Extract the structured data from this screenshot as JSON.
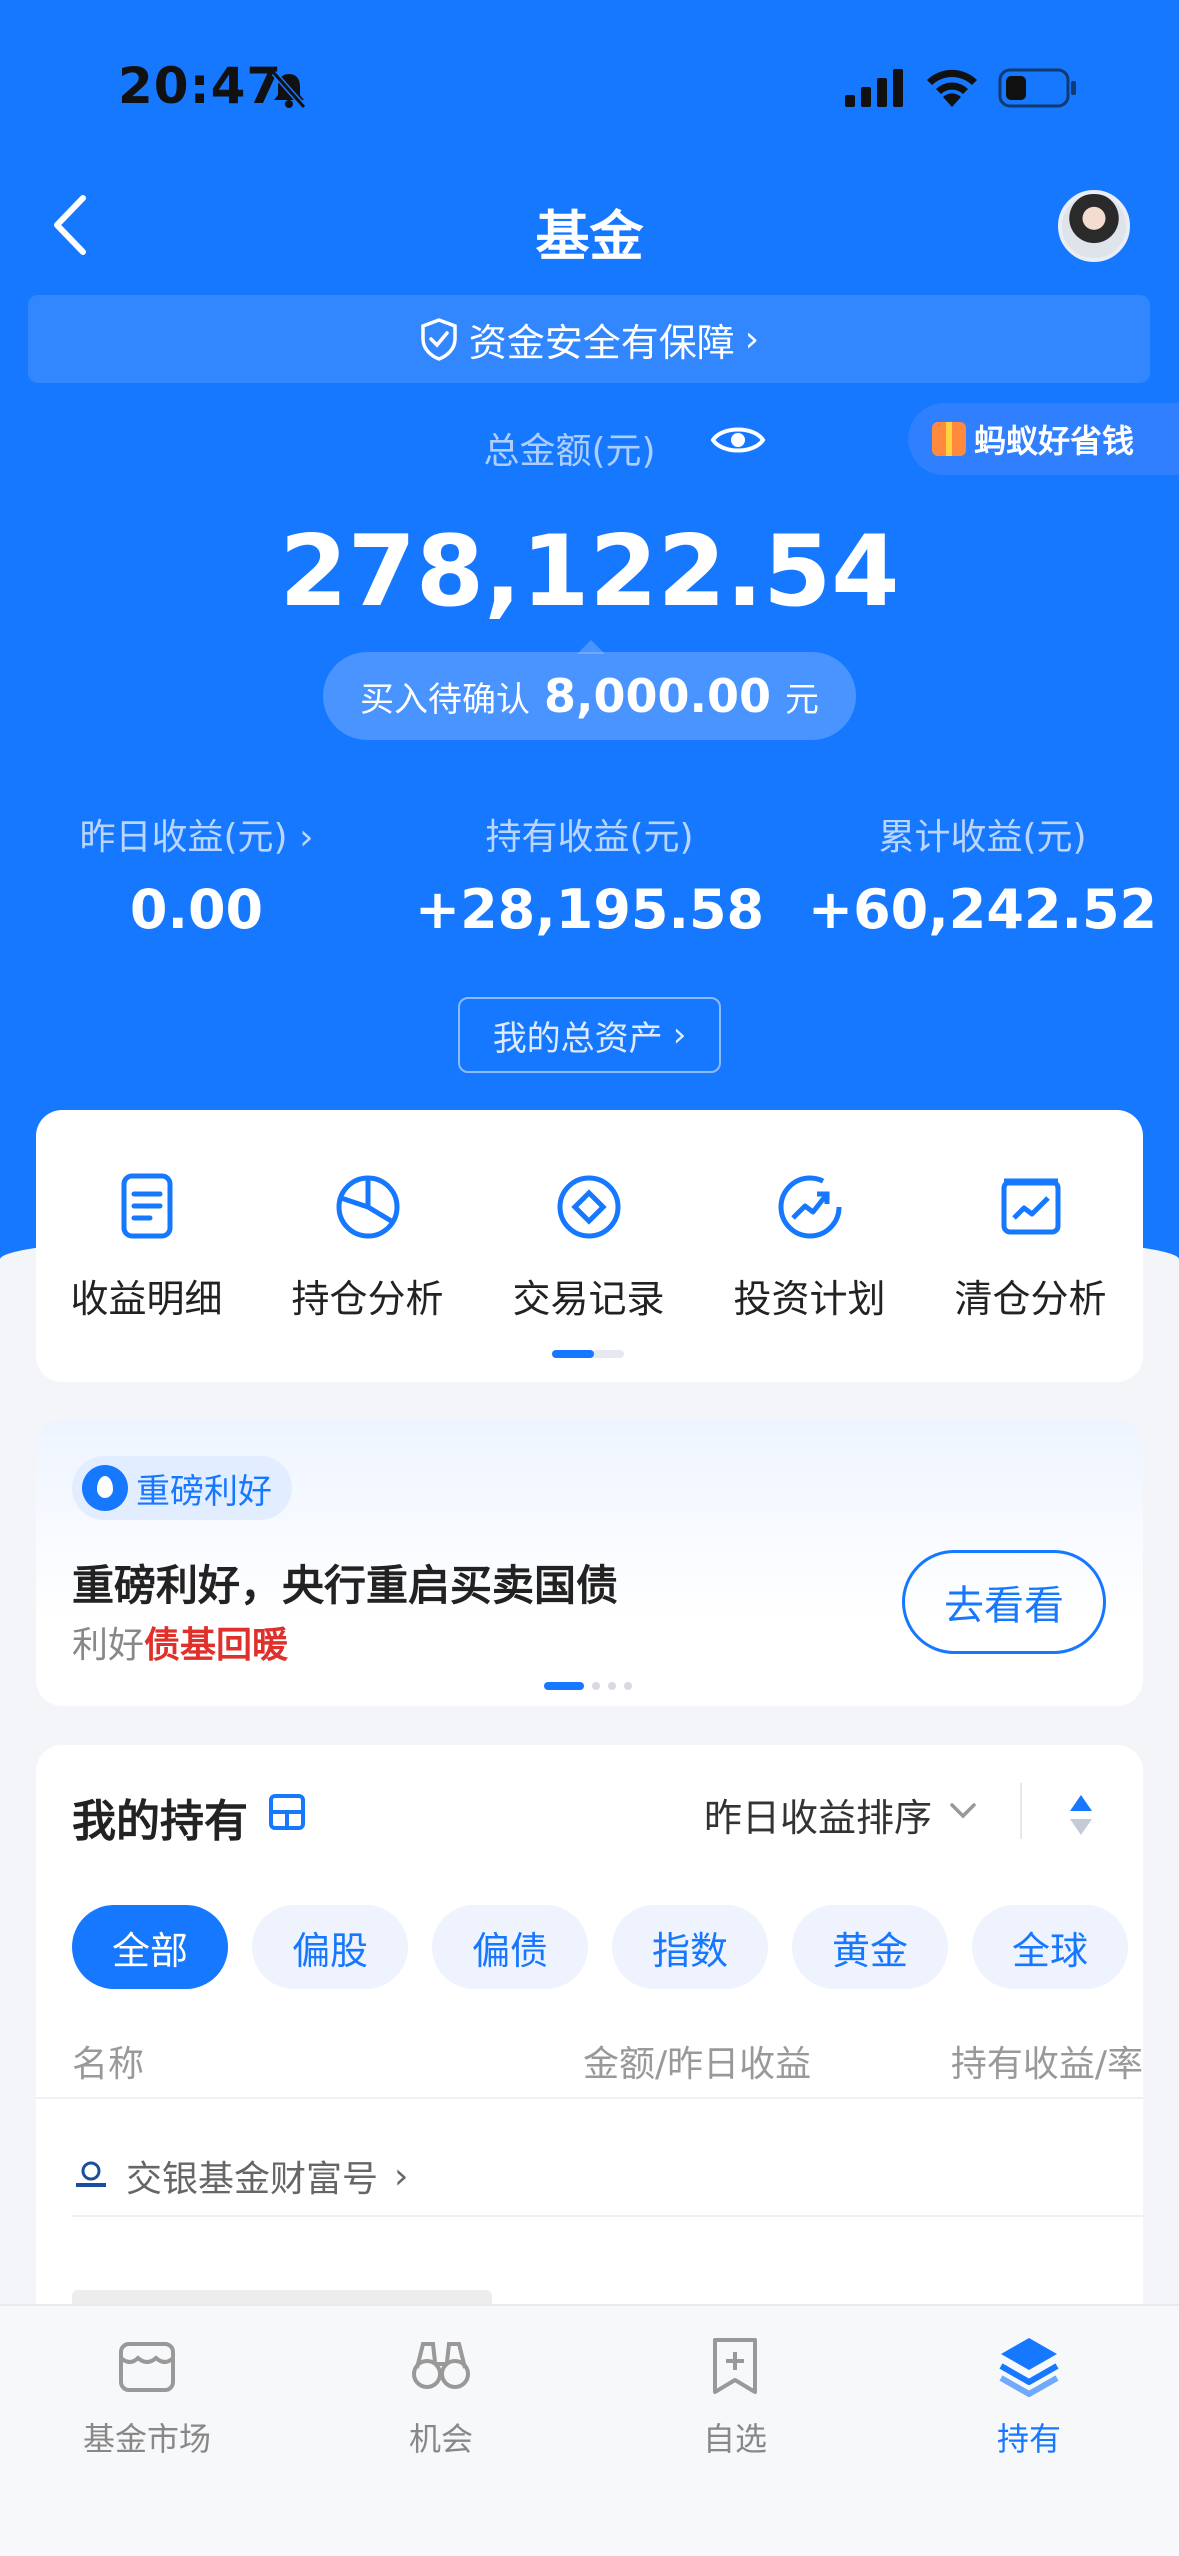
{
  "status_bar": {
    "time": "20:47"
  },
  "nav": {
    "title": "基金"
  },
  "safety": {
    "label": "资金安全有保障"
  },
  "promo": {
    "label": "蚂蚁好省钱"
  },
  "total": {
    "label": "总金额(元)",
    "amount": "278,122.54",
    "pending_label": "买入待确认",
    "pending_amount": "8,000.00",
    "pending_unit": "元"
  },
  "stats": [
    {
      "label": "昨日收益(元)",
      "value": "0.00"
    },
    {
      "label": "持有收益(元)",
      "value": "+28,195.58"
    },
    {
      "label": "累计收益(元)",
      "value": "+60,242.52"
    }
  ],
  "assets_button": "我的总资产",
  "functions": [
    {
      "label": "收益明细",
      "icon": "document-icon"
    },
    {
      "label": "持仓分析",
      "icon": "pie-chart-icon"
    },
    {
      "label": "交易记录",
      "icon": "transaction-icon"
    },
    {
      "label": "投资计划",
      "icon": "trend-up-icon"
    },
    {
      "label": "清仓分析",
      "icon": "chart-box-icon"
    }
  ],
  "news": {
    "tag": "重磅利好",
    "title": "重磅利好，央行重启买卖国债",
    "sub_prefix": "利好",
    "sub_highlight": "债基回暖",
    "button": "去看看"
  },
  "holdings": {
    "title": "我的持有",
    "sort_label": "昨日收益排序",
    "chips": [
      "全部",
      "偏股",
      "偏债",
      "指数",
      "黄金",
      "全球"
    ],
    "columns": [
      "名称",
      "金额/昨日收益",
      "持有收益/率"
    ],
    "company": "交银基金财富号"
  },
  "tabbar": [
    {
      "label": "基金市场",
      "icon": "market-icon"
    },
    {
      "label": "机会",
      "icon": "binoculars-icon"
    },
    {
      "label": "自选",
      "icon": "bookmark-plus-icon"
    },
    {
      "label": "持有",
      "icon": "layers-icon"
    }
  ],
  "colors": {
    "primary": "#1677ff",
    "highlight": "#e0302c",
    "background": "#f3f5f8"
  }
}
